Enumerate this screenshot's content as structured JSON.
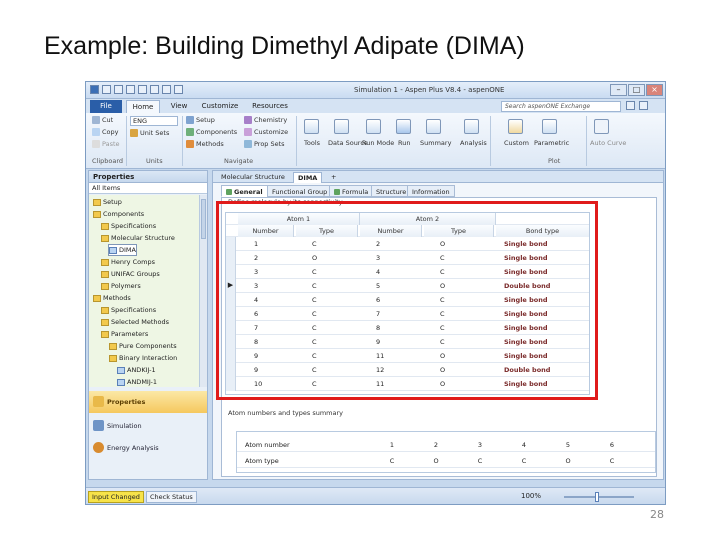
{
  "slide": {
    "title": "Example: Building Dimethyl Adipate (DIMA)",
    "page_number": "28"
  },
  "window": {
    "title": "Simulation 1 - Aspen Plus V8.4 - aspenONE",
    "search_placeholder": "Search aspenONE Exchange"
  },
  "ribbon_tabs": [
    "File",
    "Home",
    "View",
    "Customize",
    "Resources"
  ],
  "ribbon": {
    "clipboard": {
      "cut": "Cut",
      "copy": "Copy",
      "paste": "Paste",
      "group": "Clipboard"
    },
    "units": {
      "combo_value": "ENG",
      "unit_sets": "Unit Sets",
      "group": "Units"
    },
    "navigate": {
      "setup": "Setup",
      "components": "Components",
      "methods": "Methods",
      "chemistry": "Chemistry",
      "customize": "Customize",
      "prop_sets": "Prop Sets",
      "group": "Navigate"
    },
    "tools": {
      "tools": "Tools",
      "data_source": "Data Source",
      "run_mode": "Run Mode",
      "run": "Run",
      "summary": "Summary",
      "analysis": "Analysis"
    },
    "plot": {
      "custom": "Custom",
      "parametric": "Parametric",
      "group": "Plot",
      "auto_curve": "Auto Curve"
    }
  },
  "properties": {
    "header": "Properties",
    "filter": "All Items",
    "tree": [
      {
        "label": "Setup",
        "depth": 0,
        "icon": "folder"
      },
      {
        "label": "Components",
        "depth": 0,
        "icon": "folder"
      },
      {
        "label": "Specifications",
        "depth": 1,
        "icon": "folder"
      },
      {
        "label": "Molecular Structure",
        "depth": 1,
        "icon": "folder"
      },
      {
        "label": "DIMA",
        "depth": 2,
        "icon": "form",
        "selected": true
      },
      {
        "label": "Henry Comps",
        "depth": 1,
        "icon": "folder"
      },
      {
        "label": "UNIFAC Groups",
        "depth": 1,
        "icon": "folder"
      },
      {
        "label": "Polymers",
        "depth": 1,
        "icon": "folder"
      },
      {
        "label": "Methods",
        "depth": 0,
        "icon": "folder"
      },
      {
        "label": "Specifications",
        "depth": 1,
        "icon": "folder"
      },
      {
        "label": "Selected Methods",
        "depth": 1,
        "icon": "folder"
      },
      {
        "label": "Parameters",
        "depth": 1,
        "icon": "folder"
      },
      {
        "label": "Pure Components",
        "depth": 2,
        "icon": "folder"
      },
      {
        "label": "Binary Interaction",
        "depth": 2,
        "icon": "folder"
      },
      {
        "label": "ANDKIJ-1",
        "depth": 3,
        "icon": "form"
      },
      {
        "label": "ANDMIJ-1",
        "depth": 3,
        "icon": "form"
      }
    ],
    "nav": [
      "Properties",
      "Simulation",
      "Energy Analysis"
    ]
  },
  "document": {
    "tabs": [
      "Molecular Structure",
      "DIMA"
    ],
    "add_tab": "+",
    "form_tabs": [
      "General",
      "Functional Group",
      "Formula",
      "Structure",
      "Information"
    ],
    "section1_title": "Define molecule by its connectivity",
    "atom1_header": "Atom 1",
    "atom2_header": "Atom 2",
    "columns": [
      "Number",
      "Type",
      "Number",
      "Type",
      "Bond type"
    ],
    "rows": [
      [
        "1",
        "C",
        "2",
        "O",
        "Single bond"
      ],
      [
        "2",
        "O",
        "3",
        "C",
        "Single bond"
      ],
      [
        "3",
        "C",
        "4",
        "C",
        "Single bond"
      ],
      [
        "3",
        "C",
        "5",
        "O",
        "Double bond"
      ],
      [
        "4",
        "C",
        "6",
        "C",
        "Single bond"
      ],
      [
        "6",
        "C",
        "7",
        "C",
        "Single bond"
      ],
      [
        "7",
        "C",
        "8",
        "C",
        "Single bond"
      ],
      [
        "8",
        "C",
        "9",
        "C",
        "Single bond"
      ],
      [
        "9",
        "C",
        "11",
        "O",
        "Single bond"
      ],
      [
        "9",
        "C",
        "12",
        "O",
        "Double bond"
      ],
      [
        "10",
        "C",
        "11",
        "O",
        "Single bond"
      ]
    ],
    "current_row": 3,
    "section2_title": "Atom numbers and types summary",
    "summary": {
      "row_labels": [
        "Atom number",
        "Atom type"
      ],
      "numbers": [
        "1",
        "2",
        "3",
        "4",
        "5",
        "6"
      ],
      "types": [
        "C",
        "O",
        "C",
        "C",
        "O",
        "C"
      ]
    }
  },
  "status": {
    "input_changed": "Input Changed",
    "check_status": "Check Status",
    "zoom": "100%"
  }
}
